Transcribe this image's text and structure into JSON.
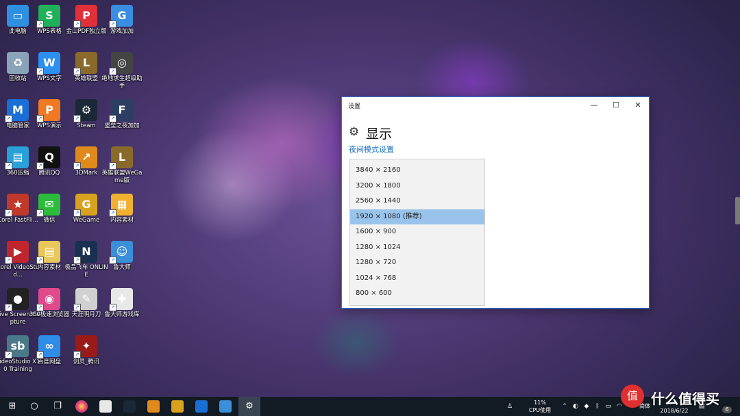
{
  "desktop": {
    "icons": [
      {
        "label": "此电脑",
        "glyph": "▭",
        "color": "#2f8fe0"
      },
      {
        "label": "WPS表格",
        "glyph": "S",
        "color": "#1fb15a"
      },
      {
        "label": "金山PDF独立版",
        "glyph": "P",
        "color": "#e0303a"
      },
      {
        "label": "游戏加加",
        "glyph": "G",
        "color": "#3a8de0"
      },
      {
        "label": "回收站",
        "glyph": "♻",
        "color": "#8aa3b8"
      },
      {
        "label": "WPS文字",
        "glyph": "W",
        "color": "#2d8ff0"
      },
      {
        "label": "英雄联盟",
        "glyph": "L",
        "color": "#8a6a2a"
      },
      {
        "label": "绝地求生超级助手",
        "glyph": "◎",
        "color": "#444"
      },
      {
        "label": "电脑管家",
        "glyph": "M",
        "color": "#1a6fd6"
      },
      {
        "label": "WPS演示",
        "glyph": "P",
        "color": "#f07a24"
      },
      {
        "label": "Steam",
        "glyph": "⚙",
        "color": "#1b2838"
      },
      {
        "label": "堡垒之夜加加",
        "glyph": "F",
        "color": "#2c3e64"
      },
      {
        "label": "360压缩",
        "glyph": "▤",
        "color": "#2aa0d8"
      },
      {
        "label": "腾讯QQ",
        "glyph": "Q",
        "color": "#111"
      },
      {
        "label": "3DMark",
        "glyph": "↗",
        "color": "#e08a1e"
      },
      {
        "label": "英雄联盟WeGame版",
        "glyph": "L",
        "color": "#8a6a2a"
      },
      {
        "label": "Corel FastFli...",
        "glyph": "★",
        "color": "#c0392b"
      },
      {
        "label": "微信",
        "glyph": "✉",
        "color": "#2dbb3c"
      },
      {
        "label": "WeGame",
        "glyph": "G",
        "color": "#d8a21e"
      },
      {
        "label": "内容素材",
        "glyph": "▦",
        "color": "#f0b030"
      },
      {
        "label": "Corel VideoStud...",
        "glyph": "▶",
        "color": "#c0262e"
      },
      {
        "label": "内容素材",
        "glyph": "▤",
        "color": "#e8c85a"
      },
      {
        "label": "极品飞车 ONLINE",
        "glyph": "N",
        "color": "#1a3050"
      },
      {
        "label": "鲁大师",
        "glyph": "☺",
        "color": "#3a8fd8"
      },
      {
        "label": "Live Screen Capture",
        "glyph": "●",
        "color": "#222"
      },
      {
        "label": "360极速浏览器",
        "glyph": "◉",
        "color": "#e04a8a"
      },
      {
        "label": "天涯明月刀",
        "glyph": "✎",
        "color": "#d0d0d0"
      },
      {
        "label": "鲁大师游戏库",
        "glyph": "✚",
        "color": "#e8e8e8"
      },
      {
        "label": "VideoStudio X10 Training",
        "glyph": "sb",
        "color": "#4a7a8a"
      },
      {
        "label": "百度网盘",
        "glyph": "∞",
        "color": "#2f8de8"
      },
      {
        "label": "剑灵_腾讯",
        "glyph": "✦",
        "color": "#9a1a1a"
      }
    ]
  },
  "window": {
    "title": "设置",
    "controls": {
      "minimize": "—",
      "maximize": "☐",
      "close": "✕"
    },
    "page_title": "显示",
    "night_link": "夜间模式设置",
    "resolutions": [
      "3840 × 2160",
      "3200 × 1800",
      "2560 × 1440",
      "1920 × 1080 (推荐)",
      "1600 × 900",
      "1280 × 1024",
      "1280 × 720",
      "1024 × 768",
      "800 × 600"
    ],
    "selected_resolution": "1920 × 1080 (推荐)"
  },
  "taskbar": {
    "cpu_percent": "11%",
    "cpu_label": "CPU使用",
    "ime": "简体",
    "date": "2018/6/22",
    "notification_count": "6"
  },
  "watermark": {
    "text": "什么值得买",
    "symbol": "值"
  }
}
